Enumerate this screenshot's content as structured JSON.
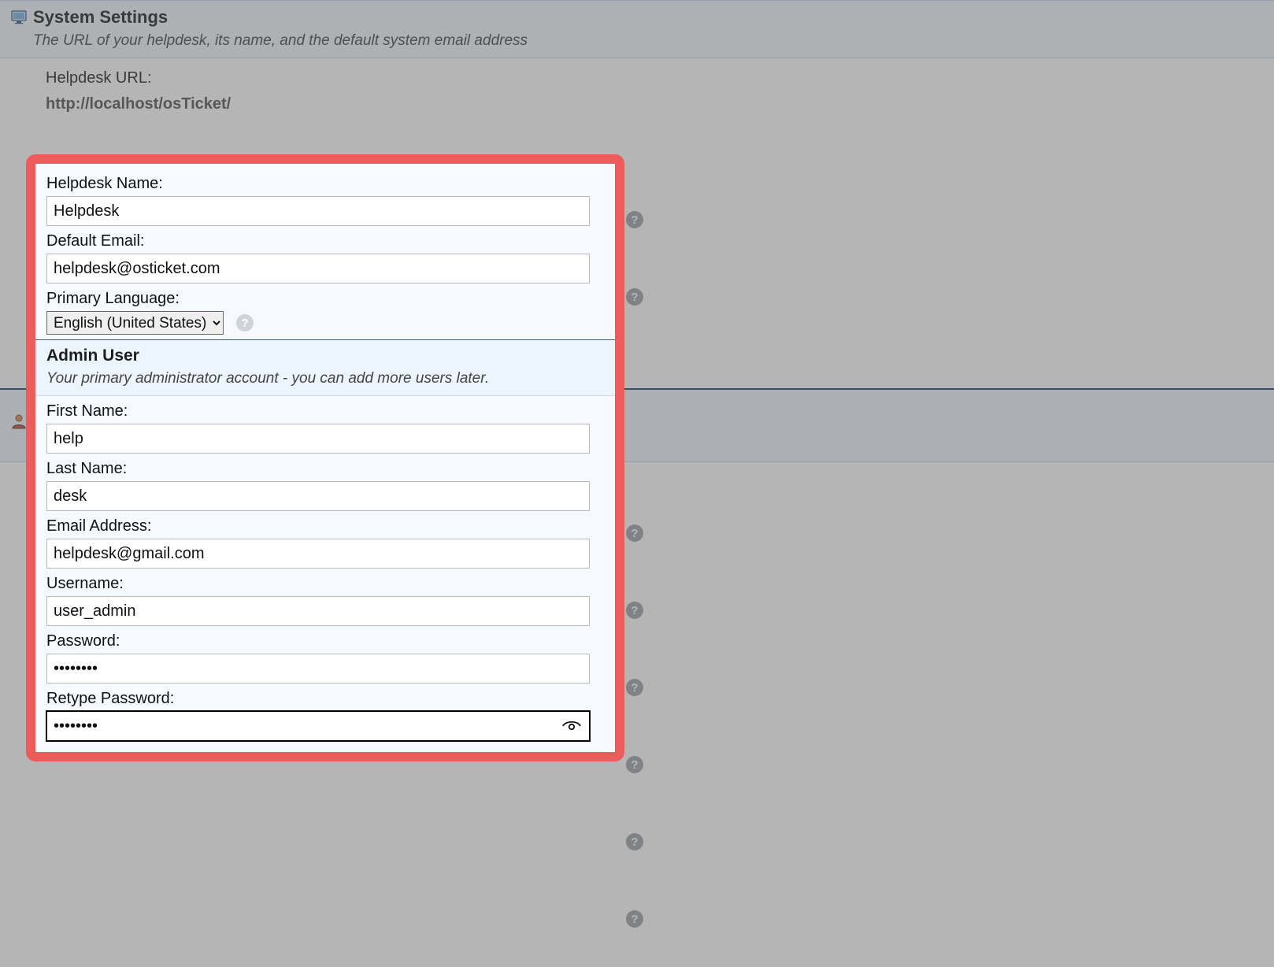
{
  "system_settings": {
    "title": "System Settings",
    "subtitle": "The URL of your helpdesk, its name, and the default system email address",
    "url_label": "Helpdesk URL:",
    "url_value": "http://localhost/osTicket/",
    "helpdesk_name_label": "Helpdesk Name:",
    "helpdesk_name_value": "Helpdesk",
    "default_email_label": "Default Email:",
    "default_email_value": "helpdesk@osticket.com",
    "primary_language_label": "Primary Language:",
    "primary_language_value": "English (United States)"
  },
  "admin_user": {
    "title": "Admin User",
    "subtitle": "Your primary administrator account - you can add more users later.",
    "first_name_label": "First Name:",
    "first_name_value": "help",
    "last_name_label": "Last Name:",
    "last_name_value": "desk",
    "email_label": "Email Address:",
    "email_value": "helpdesk@gmail.com",
    "username_label": "Username:",
    "username_value": "user_admin",
    "password_label": "Password:",
    "password_value": "••••••••",
    "retype_password_label": "Retype Password:",
    "retype_password_value": "••••••••"
  },
  "icons": {
    "help_glyph": "?"
  }
}
